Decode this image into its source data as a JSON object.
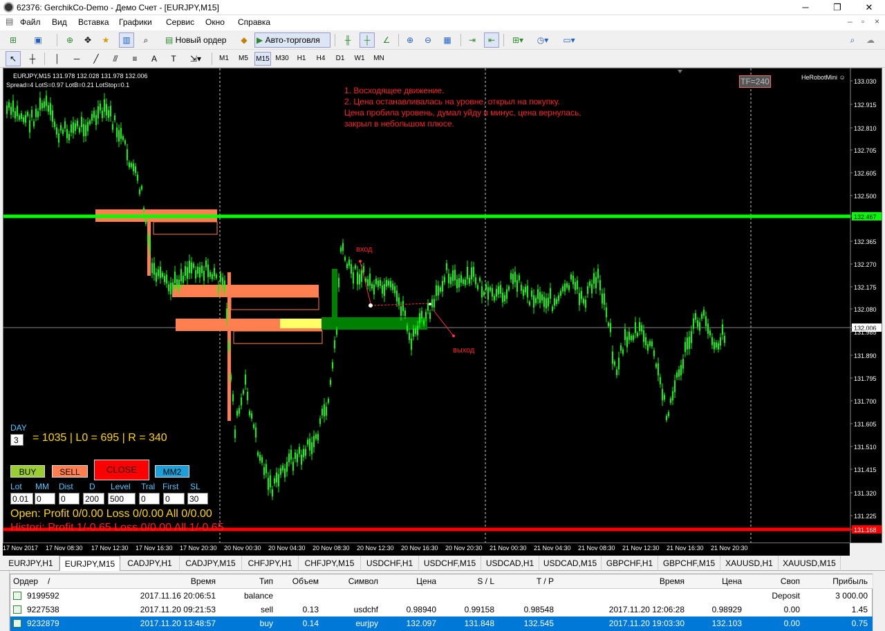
{
  "window": {
    "title": "62376: GerchikCo-Demo - Демо Счет - [EURJPY,M15]",
    "controls": {
      "minimize": "─",
      "maximize": "❐",
      "close": "✕"
    }
  },
  "menu": [
    "Файл",
    "Вид",
    "Вставка",
    "Графики",
    "Сервис",
    "Окно",
    "Справка"
  ],
  "toolbar": {
    "new_order": "Новый ордер",
    "autotrade": "Авто-торговля",
    "timeframes": [
      "M1",
      "M5",
      "M15",
      "M30",
      "H1",
      "H4",
      "D1",
      "W1",
      "MN"
    ],
    "active_timeframe": "M15"
  },
  "chart": {
    "symbol_line": "EURJPY,M15  131.978 132.028 131.978 132.006",
    "info_line": "Spread=4  LotS=0.97  LotB=0.21  LotStop=0.1",
    "robot_label": "HeRobotMini",
    "tf_box": "TF=240",
    "annotation": "1. Восходящее движение.\n2. Цена останавливалась на уровне, открыл на покупку.\nЦена пробила уровень, думал уйду в минус, цена вернулась,\nзакрыл в небольшом плюсе.",
    "label_entry": "вход",
    "label_exit": "выход",
    "price_axis": [
      "133.030",
      "132.915",
      "132.810",
      "132.705",
      "132.605",
      "132.500",
      "132.467",
      "132.365",
      "132.270",
      "132.175",
      "132.080",
      "132.006",
      "131.985",
      "131.890",
      "131.795",
      "131.700",
      "131.605",
      "131.510",
      "131.415",
      "131.320",
      "131.225",
      "131.168"
    ],
    "green_level": "132.467",
    "current_price": "132.006",
    "red_level": "131.168",
    "time_axis": [
      "17 Nov 2017",
      "17 Nov 08:30",
      "17 Nov 12:30",
      "17 Nov 16:30",
      "17 Nov 20:30",
      "20 Nov 00:30",
      "20 Nov 04:30",
      "20 Nov 08:30",
      "20 Nov 12:30",
      "20 Nov 16:30",
      "20 Nov 20:30",
      "21 Nov 00:30",
      "21 Nov 04:30",
      "21 Nov 08:30",
      "21 Nov 12:30",
      "21 Nov 16:30",
      "21 Nov 20:30"
    ],
    "colors": {
      "candle": "#00ff00",
      "green_level": "#00ff00",
      "red_level": "#ff0000",
      "zone": "#ff7f50",
      "annotation": "#ff2020",
      "panel_label": "#4ec9ff",
      "panel_text": "#ffd700"
    }
  },
  "panel": {
    "day_label": "DAY",
    "day_value": "3",
    "day_stats": "= 1035 | L0 = 695 | R = 340",
    "buttons": {
      "buy": "BUY",
      "sell": "SELL",
      "close": "CLOSE",
      "mm2": "MM2"
    },
    "field_labels": [
      "Lot",
      "MM",
      "Dist",
      "D",
      "Level",
      "Tral",
      "First",
      "SL"
    ],
    "field_values": [
      "0.01",
      "0",
      "0",
      "200",
      "500",
      "0",
      "0",
      "30"
    ],
    "open_line": "Open:  Profit 0/0.00  Loss 0/0.00  All 0/0.00",
    "history_line": "Histori: Profit 1/-0.65  Loss 0/0.00  All 1/-0.65"
  },
  "tabs": [
    "EURJPY,H1",
    "EURJPY,M15",
    "CADJPY,H1",
    "CADJPY,M15",
    "CHFJPY,H1",
    "CHFJPY,M15",
    "USDCHF,H1",
    "USDCHF,M15",
    "USDCAD,H1",
    "USDCAD,M15",
    "GBPCHF,H1",
    "GBPCHF,M15",
    "XAUUSD,H1",
    "XAUUSD,M15"
  ],
  "active_tab": "EURJPY,M15",
  "terminal": {
    "columns": [
      "Ордер",
      "/",
      "Время",
      "Тип",
      "Объем",
      "Символ",
      "Цена",
      "S / L",
      "T / P",
      "Время",
      "Цена",
      "Своп",
      "Прибыль"
    ],
    "rows": [
      [
        "9199592",
        "2017.11.16 20:06:51",
        "balance",
        "",
        "",
        "",
        "",
        "",
        "",
        "",
        "Deposit",
        "3 000.00"
      ],
      [
        "9227538",
        "2017.11.20 09:21:53",
        "sell",
        "0.13",
        "usdchf",
        "0.98940",
        "0.99158",
        "0.98548",
        "2017.11.20 12:06:28",
        "0.98929",
        "0.00",
        "1.45"
      ],
      [
        "9232879",
        "2017.11.20 13:48:57",
        "buy",
        "0.14",
        "eurjpy",
        "132.097",
        "131.848",
        "132.545",
        "2017.11.20 19:03:30",
        "132.103",
        "0.00",
        "0.75"
      ]
    ]
  }
}
